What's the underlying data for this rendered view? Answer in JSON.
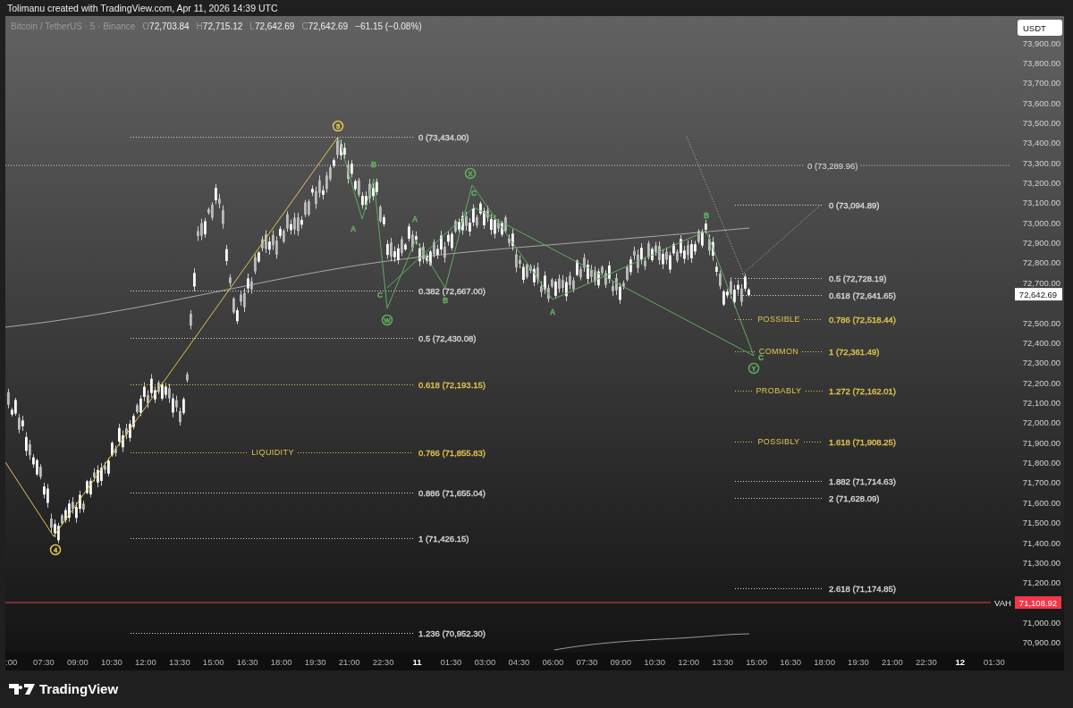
{
  "header": {
    "text": "Tolimanu created with TradingView.com, Apr 11, 2026 14:39 UTC"
  },
  "legend": {
    "symbol": "Bitcoin / TetherUS · 5 · Binance",
    "ohlc": [
      {
        "key": "O",
        "value": "72,703.84"
      },
      {
        "key": "H",
        "value": "72,715.12"
      },
      {
        "key": "L",
        "value": "72,642.69"
      },
      {
        "key": "C",
        "value": "72,642.69"
      }
    ],
    "change": "−61.15 (−0.08%)"
  },
  "price_axis": {
    "currency": "USDT",
    "ticks": [
      "73,900.00",
      "73,800.00",
      "73,700.00",
      "73,600.00",
      "73,500.00",
      "73,400.00",
      "73,300.00",
      "73,200.00",
      "73,100.00",
      "73,000.00",
      "72,900.00",
      "72,800.00",
      "72,700.00",
      "72,500.00",
      "72,400.00",
      "72,300.00",
      "72,200.00",
      "72,100.00",
      "72,000.00",
      "71,900.00",
      "71,800.00",
      "71,700.00",
      "71,600.00",
      "71,500.00",
      "71,400.00",
      "71,300.00",
      "71,200.00",
      "71,000.00",
      "70,900.00"
    ],
    "last_price": "72,642.69"
  },
  "vah": {
    "label": "VAH",
    "price": "71,108.92"
  },
  "fib_left": {
    "levels": [
      {
        "label": "0 (73,434.00)",
        "color": "#d9d9d9"
      },
      {
        "label": "0.382 (72,667.00)",
        "color": "#d9d9d9"
      },
      {
        "label": "0.5 (72,430.08)",
        "color": "#d9d9d9"
      },
      {
        "label": "0.618 (72,193.15)",
        "color": "#e3c64c"
      },
      {
        "label": "0.786 (71,855.83)",
        "color": "#e3c64c",
        "tag": "LIQUIDITY"
      },
      {
        "label": "0.886 (71,655.04)",
        "color": "#d9d9d9"
      },
      {
        "label": "1 (71,426.15)",
        "color": "#d9d9d9"
      },
      {
        "label": "1.236 (70,952.30)",
        "color": "#d9d9d9"
      }
    ]
  },
  "fib_right": {
    "levels": [
      {
        "label": "0 (73,094.89)",
        "color": "#d9d9d9"
      },
      {
        "label": "0.5 (72,728.19)",
        "color": "#d9d9d9"
      },
      {
        "label": "0.618 (72,641.65)",
        "color": "#d9d9d9"
      },
      {
        "label": "0.786 (72,518.44)",
        "color": "#e3c64c",
        "tag": "POSSIBLE"
      },
      {
        "label": "1 (72,361.49)",
        "color": "#e3c64c",
        "tag": "COMMON"
      },
      {
        "label": "1.272 (72,162.01)",
        "color": "#e3c64c",
        "tag": "PROBABLY"
      },
      {
        "label": "1.618 (71,908.25)",
        "color": "#e3c64c",
        "tag": "POSSIBLY"
      },
      {
        "label": "1.882 (71,714.63)",
        "color": "#d9d9d9"
      },
      {
        "label": "2 (71,628.09)",
        "color": "#d9d9d9"
      },
      {
        "label": "2.618 (71,174.85)",
        "color": "#d9d9d9"
      }
    ]
  },
  "extra_level": {
    "label": "0 (73,289.96)"
  },
  "wave_labels": [
    {
      "text": "5",
      "circled": true,
      "color": "#e3c64c"
    },
    {
      "text": "4",
      "circled": true,
      "color": "#e3c64c"
    },
    {
      "text": "B",
      "circled": false,
      "color": "#5fae5f"
    },
    {
      "text": "A",
      "circled": false,
      "color": "#5fae5f"
    },
    {
      "text": "C",
      "circled": false,
      "color": "#5fae5f"
    },
    {
      "text": "W",
      "circled": true,
      "color": "#5fae5f"
    },
    {
      "text": "A",
      "circled": false,
      "color": "#5fae5f"
    },
    {
      "text": "B",
      "circled": false,
      "color": "#5fae5f"
    },
    {
      "text": "X",
      "circled": true,
      "color": "#5fae5f"
    },
    {
      "text": "C",
      "circled": false,
      "color": "#5fae5f"
    },
    {
      "text": "A",
      "circled": false,
      "color": "#5fae5f"
    },
    {
      "text": "B",
      "circled": false,
      "color": "#5fae5f"
    },
    {
      "text": "C",
      "circled": false,
      "color": "#5fae5f"
    },
    {
      "text": "Y",
      "circled": true,
      "color": "#5fae5f"
    }
  ],
  "time_axis": {
    "labels": [
      {
        "text": ":00",
        "bold": false
      },
      {
        "text": "07:30",
        "bold": false
      },
      {
        "text": "09:00",
        "bold": false
      },
      {
        "text": "10:30",
        "bold": false
      },
      {
        "text": "12:00",
        "bold": false
      },
      {
        "text": "13:30",
        "bold": false
      },
      {
        "text": "15:00",
        "bold": false
      },
      {
        "text": "16:30",
        "bold": false
      },
      {
        "text": "18:00",
        "bold": false
      },
      {
        "text": "19:30",
        "bold": false
      },
      {
        "text": "21:00",
        "bold": false
      },
      {
        "text": "22:30",
        "bold": false
      },
      {
        "text": "11",
        "bold": true
      },
      {
        "text": "01:30",
        "bold": false
      },
      {
        "text": "03:00",
        "bold": false
      },
      {
        "text": "04:30",
        "bold": false
      },
      {
        "text": "06:00",
        "bold": false
      },
      {
        "text": "07:30",
        "bold": false
      },
      {
        "text": "09:00",
        "bold": false
      },
      {
        "text": "10:30",
        "bold": false
      },
      {
        "text": "12:00",
        "bold": false
      },
      {
        "text": "13:30",
        "bold": false
      },
      {
        "text": "15:00",
        "bold": false
      },
      {
        "text": "16:30",
        "bold": false
      },
      {
        "text": "18:00",
        "bold": false
      },
      {
        "text": "19:30",
        "bold": false
      },
      {
        "text": "21:00",
        "bold": false
      },
      {
        "text": "22:30",
        "bold": false
      },
      {
        "text": "12",
        "bold": true
      },
      {
        "text": "01:30",
        "bold": false
      }
    ]
  },
  "footer": {
    "brand": "TradingView"
  }
}
